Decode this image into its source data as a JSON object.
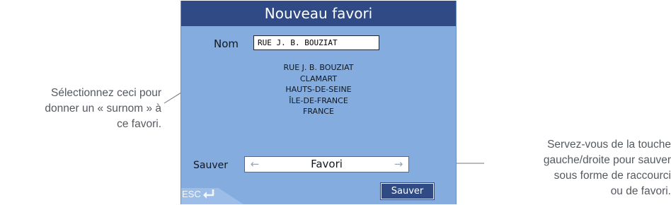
{
  "dialog": {
    "title": "Nouveau favori",
    "name_label": "Nom",
    "name_value": "RUE J. B. BOUZIAT",
    "address_lines": [
      "RUE J. B. BOUZIAT",
      "CLAMART",
      "HAUTS-DE-SEINE",
      "ÎLE-DE-FRANCE",
      "FRANCE"
    ],
    "save_label": "Sauver",
    "save_option": "Favori",
    "save_button": "Sauver",
    "esc_label": "ESC"
  },
  "annotations": {
    "left": [
      "Sélectionnez ceci pour",
      "donner un « surnom » à",
      "ce favori."
    ],
    "right": [
      "Servez-vous de la touche",
      "gauche/droite pour sauver",
      "sous forme de raccourci",
      "ou de favori."
    ]
  },
  "colors": {
    "title_bar": "#2f4a85",
    "panel": "#84acdf",
    "annotation_text": "#555a60"
  },
  "icons": {
    "left_arrow": "arrow-left-icon",
    "right_arrow": "arrow-right-icon",
    "esc_back": "return-arrow-icon"
  }
}
